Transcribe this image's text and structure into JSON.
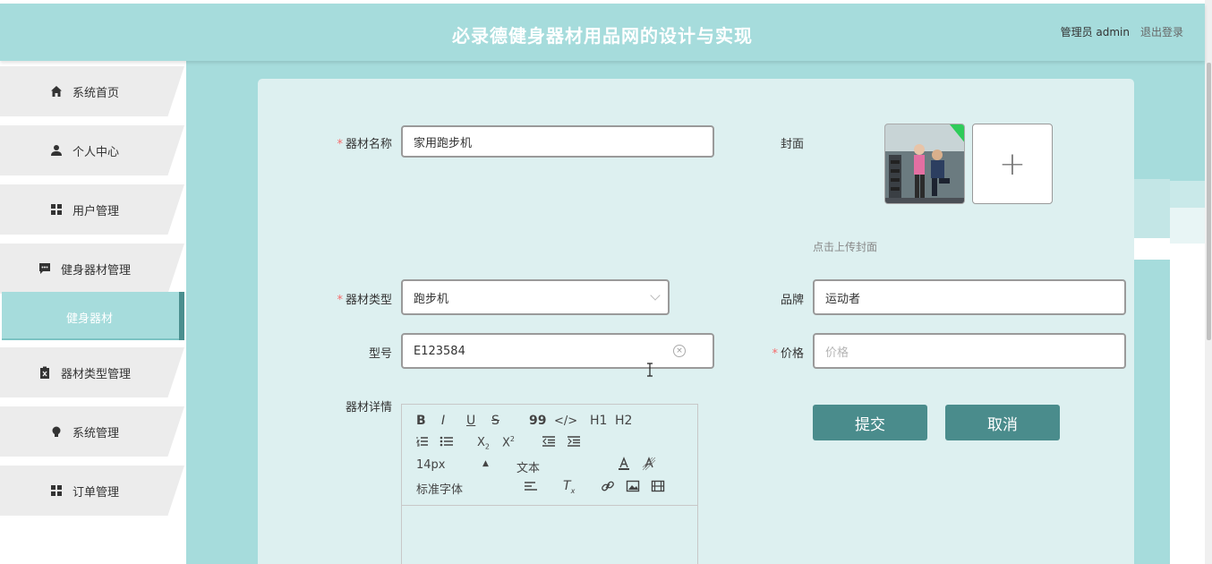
{
  "header": {
    "title": "必录德健身器材用品网的设计与实现",
    "user_label": "管理员 admin",
    "logout_label": "退出登录"
  },
  "sidebar": {
    "items": [
      {
        "label": "系统首页",
        "icon": "home-icon"
      },
      {
        "label": "个人中心",
        "icon": "person-icon"
      },
      {
        "label": "用户管理",
        "icon": "grid-icon"
      },
      {
        "label": "健身器材管理",
        "icon": "chat-icon"
      },
      {
        "label": "器材类型管理",
        "icon": "clipboard-icon"
      },
      {
        "label": "系统管理",
        "icon": "bulb-icon"
      },
      {
        "label": "订单管理",
        "icon": "grid-icon"
      }
    ],
    "active_sub": "健身器材"
  },
  "form": {
    "name_label": "器材名称",
    "name_value": "家用跑步机",
    "cover_label": "封面",
    "cover_hint": "点击上传封面",
    "upload_plus": "+",
    "type_label": "器材类型",
    "type_value": "跑步机",
    "brand_label": "品牌",
    "brand_value": "运动者",
    "model_label": "型号",
    "model_value": "E123584",
    "price_label": "价格",
    "price_placeholder": "价格",
    "detail_label": "器材详情",
    "required_mark": "*",
    "submit_label": "提交",
    "cancel_label": "取消"
  },
  "editor": {
    "font_size": "14px",
    "text_style": "文本",
    "font_family": "标准字体",
    "buttons": [
      "B",
      "I",
      "U",
      "S",
      "99",
      "</>",
      "H1",
      "H2"
    ]
  },
  "colors": {
    "accent": "#a6dcdc",
    "button": "#4a8c8c",
    "required": "#f56c6c"
  }
}
